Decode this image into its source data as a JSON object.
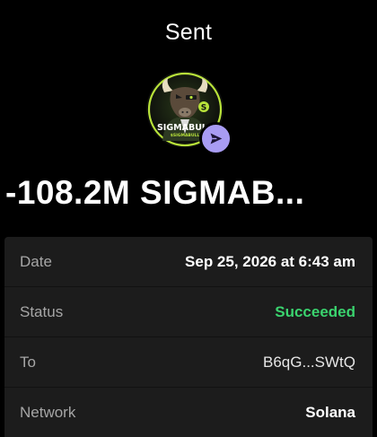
{
  "header": {
    "title": "Sent"
  },
  "token": {
    "logo_icon": "sigmabull-token-logo",
    "badge_icon": "send-arrow-icon",
    "badge_color": "#a89cf3",
    "logo_text": "SIGMABULL",
    "logo_subtext": "$SIGMABULL"
  },
  "transaction": {
    "amount": "-108.2M SIGMAB..."
  },
  "details": {
    "rows": [
      {
        "label": "Date",
        "value": "Sep 25, 2026 at 6:43 am"
      },
      {
        "label": "Status",
        "value": "Succeeded"
      },
      {
        "label": "To",
        "value": "B6qG...SWtQ"
      },
      {
        "label": "Network",
        "value": "Solana"
      }
    ]
  },
  "colors": {
    "background": "#000000",
    "card": "#1c1c1c",
    "success": "#3ad36e",
    "label": "#a6a6a6"
  }
}
